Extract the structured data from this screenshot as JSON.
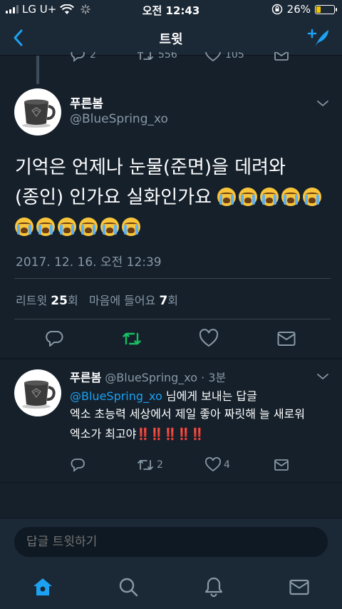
{
  "status_bar": {
    "carrier": "LG U+",
    "time": "오전 12:43",
    "battery_percent": "26%",
    "battery_level": 0.26
  },
  "nav": {
    "title": "트윗"
  },
  "prev_tweet_actions": {
    "reply_count": "2",
    "retweet_count": "556",
    "like_count": "105"
  },
  "main_tweet": {
    "name": "푸른봄",
    "handle": "@BlueSpring_xo",
    "text_line1": "기억은 언제나 눈물(준면)을 데려와",
    "text_line2": "(종인) 인가요 실화인가요",
    "emoji_name": "loudly-crying-face",
    "emoji_line2_count": 5,
    "emoji_line3_count": 6,
    "date": "2017. 12. 16. 오전 12:39",
    "retweet_label": "리트윗",
    "retweet_count": "25",
    "count_suffix": "회",
    "like_label": "마음에 들어요",
    "like_count": "7",
    "like_suffix": "회"
  },
  "reply": {
    "name": "푸른봄",
    "handle": "@BlueSpring_xo",
    "time": "· 3분",
    "reply_to_handle": "@BlueSpring_xo",
    "reply_to_suffix": " 님에게 보내는 답글",
    "text": "엑소 초능력 세상에서 제일 좋아 짜릿해 늘 새로워 엑소가 최고야",
    "bangs": "‼️‼️‼️‼️‼️",
    "retweet_count": "2",
    "like_count": "4"
  },
  "reply_input": {
    "placeholder": "답글 트윗하기"
  },
  "colors": {
    "background": "#15202b",
    "accent": "#1da1f2",
    "retweet_green": "#17bf63",
    "muted": "#8899a6"
  },
  "tabs": [
    "home-icon",
    "search-icon",
    "notifications-icon",
    "messages-icon"
  ]
}
